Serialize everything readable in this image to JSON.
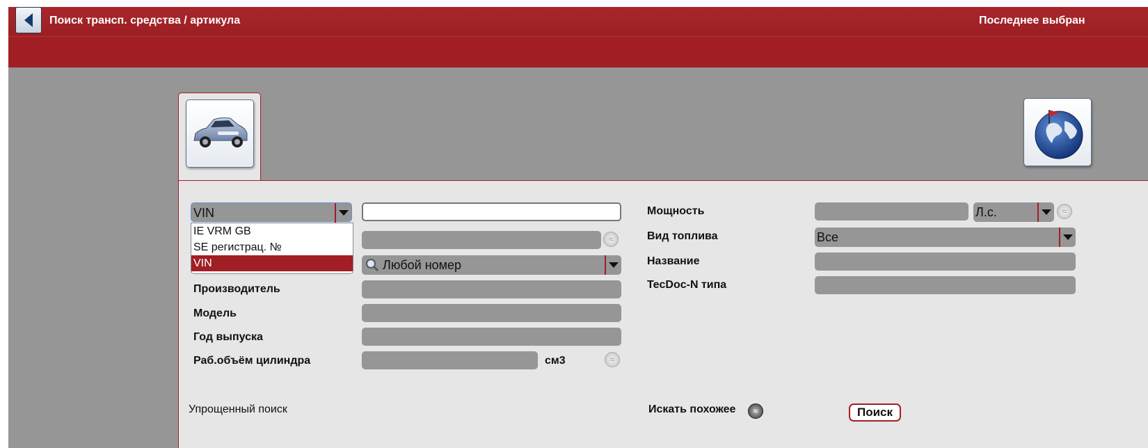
{
  "header": {
    "title": "Поиск трансп. средства / артикула",
    "recent": "Последнее выбран"
  },
  "colors": {
    "brand": "#a11e24",
    "field": "#969696",
    "panel": "#e6e6e6"
  },
  "icons": {
    "back": "back-arrow-icon",
    "car": "car-icon",
    "globe": "globe-icon"
  },
  "search_type": {
    "selected": "VIN",
    "options": [
      "IE VRM GB",
      "SE регистрац. №",
      "VIN"
    ]
  },
  "number_filter": {
    "value": "Любой номер"
  },
  "left_labels": {
    "manufacturer": "Производитель",
    "model": "Модель",
    "year": "Год выпуска",
    "displacement": "Раб.объём цилиндра",
    "displacement_unit": "см3"
  },
  "right_labels": {
    "power": "Мощность",
    "power_unit": "Л.с.",
    "fuel": "Вид топлива",
    "fuel_value": "Все",
    "name": "Название",
    "tecdoc": "TecDoc-N типа"
  },
  "footer": {
    "simple_search": "Упрощенный поиск",
    "search_similar": "Искать похожее",
    "search_button": "Поиск"
  }
}
